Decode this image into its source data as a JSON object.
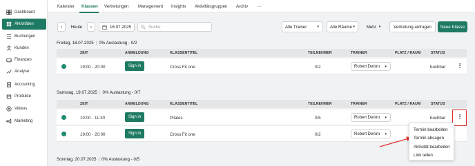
{
  "sidebar": {
    "items": [
      {
        "label": "Dashboard",
        "icon": "dashboard-icon"
      },
      {
        "label": "Aktivitäten",
        "icon": "grid-icon",
        "active": true
      },
      {
        "label": "Buchungen",
        "icon": "list-icon"
      },
      {
        "label": "Kunden",
        "icon": "user-icon"
      },
      {
        "label": "Finanzen",
        "icon": "wallet-icon"
      },
      {
        "label": "Analyse",
        "icon": "chart-icon"
      },
      {
        "label": "Accounting",
        "icon": "document-icon"
      },
      {
        "label": "Produkte",
        "icon": "box-icon"
      },
      {
        "label": "Videos",
        "icon": "play-icon"
      },
      {
        "label": "Marketing",
        "icon": "megaphone-icon"
      }
    ]
  },
  "tabs": [
    "Kalender",
    "Klassen",
    "Vertretungen",
    "Management",
    "Insights",
    "Aktivitätsgruppen",
    "Archiv",
    "···"
  ],
  "toolbar": {
    "prev": "‹",
    "today": "Heute",
    "next": "›",
    "date": "16.07.2025",
    "search_placeholder": "Suche",
    "trainer_filter": "Alle Trainer",
    "room_filter": "Alle Räume",
    "more": "Mehr",
    "request_substitute": "Vertretung anfragen",
    "new_class": "Neue Klasse"
  },
  "columns": {
    "time": "ZEIT",
    "signup": "ANMELDUNG",
    "title": "KLASSENTITEL",
    "participants": "TEILNEHMER",
    "trainer": "TRAINER",
    "room": "PLATZ / RAUM",
    "status": "STATUS"
  },
  "days": [
    {
      "date": "Freitag, 18.07.2025",
      "utilization": "0% Auslastung - 0/2",
      "rows": [
        {
          "time": "19:00 - 20:00",
          "button": "Sign in",
          "title": "Cross Fit one",
          "participants": "0/2",
          "trainer": "Robert Deniro",
          "status": "buchbar"
        }
      ]
    },
    {
      "date": "Samstag, 19.07.2025",
      "utilization": "0% Auslastung - 0/7",
      "rows": [
        {
          "time": "10:00 - 11:30",
          "button": "Sign in",
          "title": "Pilates",
          "participants": "0/5",
          "trainer": "Robert Deniro",
          "status": "buchbar"
        },
        {
          "time": "19:00 - 20:00",
          "button": "Sign in",
          "title": "Cross Fit one",
          "participants": "0/2",
          "trainer": "Robert Deniro",
          "status": ""
        }
      ]
    },
    {
      "date": "Sonntag, 20.07.2025",
      "utilization": "0% Auslastung - 0/5",
      "rows": []
    }
  ],
  "context_menu": [
    "Termin bearbeiten",
    "Termin absagen",
    "Aktivität bearbeiten",
    "Link teilen"
  ],
  "kebab": "⋮",
  "colors": {
    "accent": "#1f7a63",
    "highlight": "#e0302e"
  }
}
